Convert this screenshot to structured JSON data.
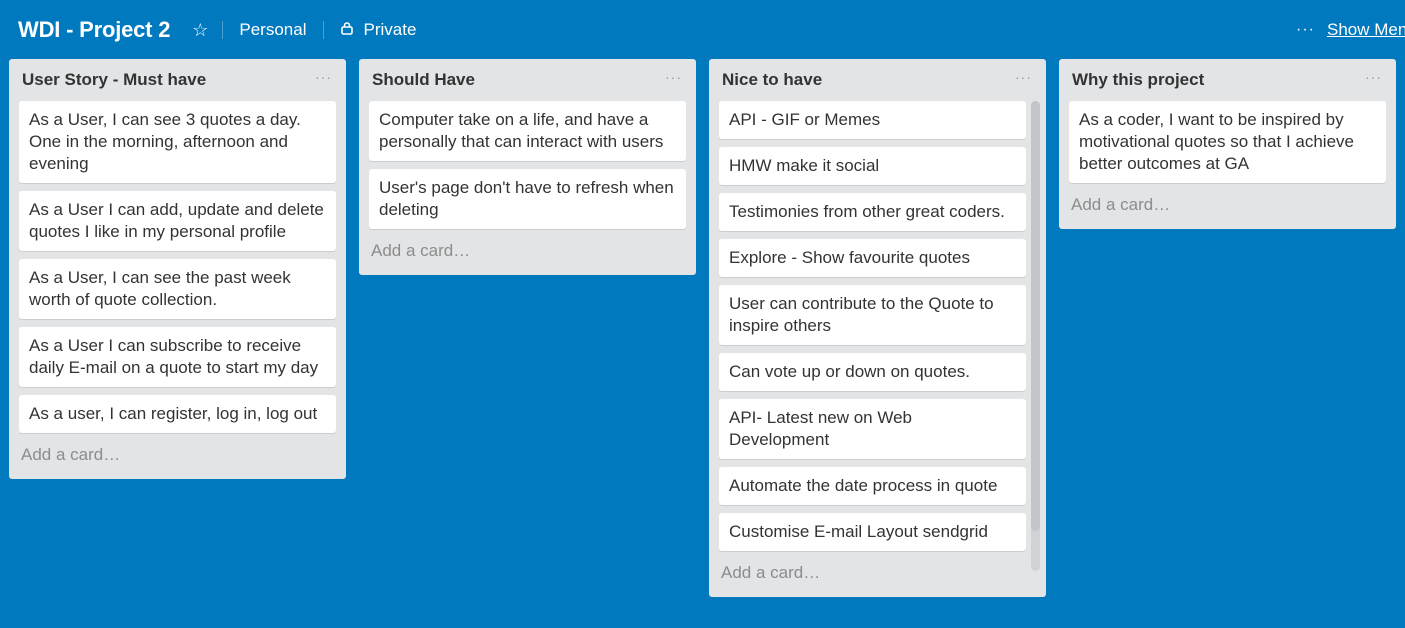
{
  "header": {
    "board_title": "WDI - Project 2",
    "team": "Personal",
    "visibility": "Private",
    "show_menu_label": "Show Menu"
  },
  "lists": [
    {
      "title": "User Story - Must have",
      "cards": [
        "As a User, I can see 3 quotes a day. One in the morning, afternoon and evening",
        "As a User I can add, update and delete quotes I like in my personal profile",
        "As a User, I can see the past week worth of quote collection.",
        "As a User I can subscribe to receive daily E-mail on a quote to start my day",
        "As a user, I can register, log in, log out"
      ],
      "add_card": "Add a card…"
    },
    {
      "title": "Should Have",
      "cards": [
        "Computer take on a life, and have a personally that can interact with users",
        "User's page don't have to refresh when deleting"
      ],
      "add_card": "Add a card…"
    },
    {
      "title": "Nice to have",
      "cards": [
        "API - GIF or Memes",
        "HMW make it social",
        "Testimonies from other great coders.",
        "Explore - Show favourite quotes",
        "User can contribute to the Quote to inspire others",
        "Can vote up or down on quotes.",
        "API- Latest new on Web Development",
        "Automate the date process in quote",
        "Customise E-mail Layout sendgrid"
      ],
      "add_card": "Add a card…"
    },
    {
      "title": "Why this project",
      "cards": [
        "As a coder, I want to be inspired by motivational quotes so that I achieve better outcomes at GA"
      ],
      "add_card": "Add a card…"
    }
  ]
}
